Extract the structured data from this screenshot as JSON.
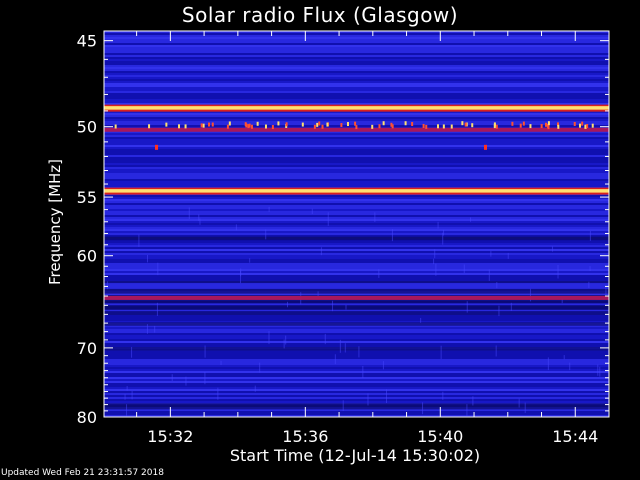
{
  "chart_data": {
    "type": "heatmap",
    "title": "Solar radio Flux (Glasgow)",
    "xlabel": "Start Time (12-Jul-14 15:30:02)",
    "ylabel": "Frequency [MHz]",
    "xlim": [
      "15:30:02",
      "15:45:00"
    ],
    "ylim": [
      80,
      44.5
    ],
    "y_scale": "reciprocal",
    "x_ticks": [
      "15:32",
      "15:36",
      "15:40",
      "15:44"
    ],
    "y_ticks": [
      45,
      50,
      55,
      60,
      70,
      80
    ],
    "colormap": "blue-red-yellow",
    "background_flux_color": "#1f1fd8",
    "bright_bands_mhz": [
      {
        "freq": 48.8,
        "intensity": "high"
      },
      {
        "freq": 50.2,
        "intensity": "medium"
      },
      {
        "freq": 54.5,
        "intensity": "high"
      },
      {
        "freq": 64.2,
        "intensity": "medium"
      }
    ],
    "grid": false
  },
  "footer": "Updated Wed Feb 21 23:31:57 2018",
  "colors": {
    "background": "#000000",
    "text": "#ffffff",
    "band_hot": "#ffe070",
    "band_mid": "#d82020"
  }
}
